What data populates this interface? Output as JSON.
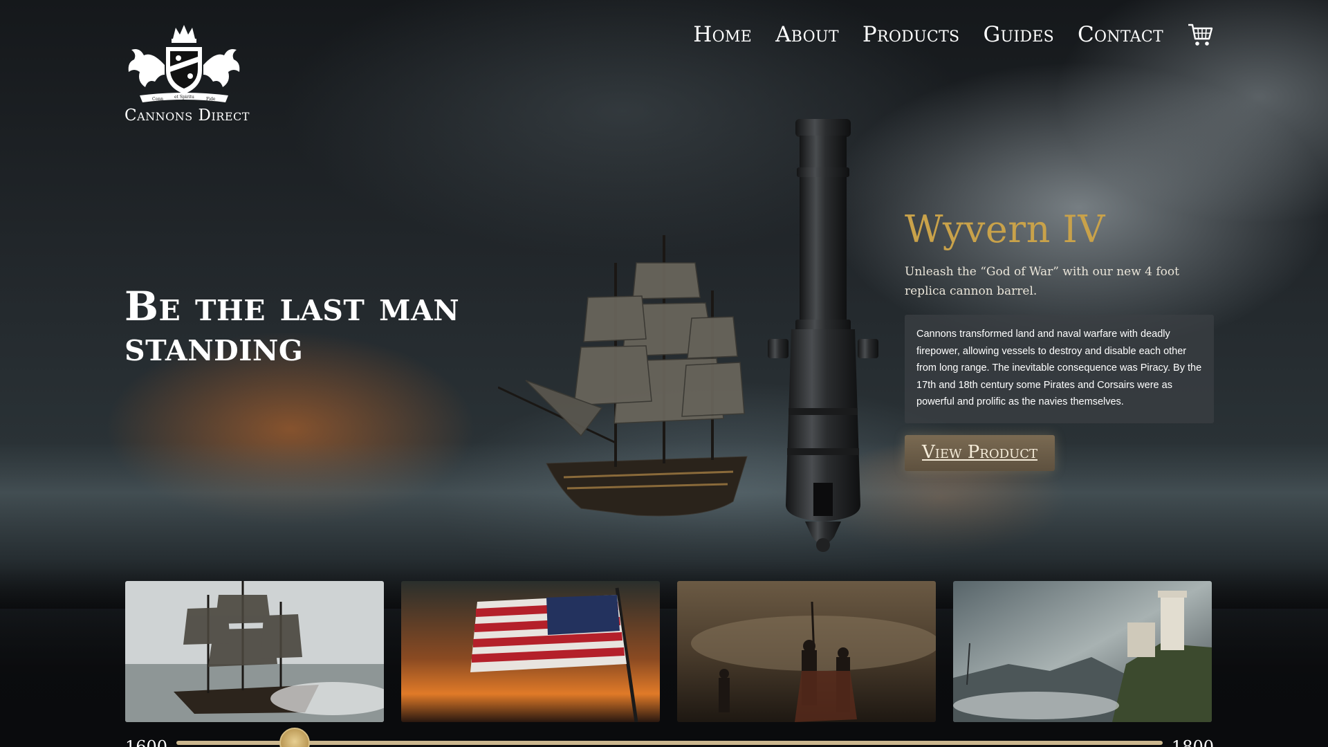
{
  "brand": {
    "name": "Cannons Direct",
    "motto_left": "Conn",
    "motto_center": "et Spiritu",
    "motto_right": "Fide"
  },
  "nav": {
    "items": [
      {
        "label": "Home"
      },
      {
        "label": "About"
      },
      {
        "label": "Products"
      },
      {
        "label": "Guides"
      },
      {
        "label": "Contact"
      }
    ],
    "cart_icon": "shopping-cart-icon"
  },
  "hero": {
    "headline": "Be the last man standing"
  },
  "product": {
    "name": "Wyvern IV",
    "tagline": "Unleash the “God of War” with our new 4 foot replica cannon barrel.",
    "description": "Cannons transformed land and naval warfare with deadly firepower, allowing vessels to destroy and disable each other from long range. The inevitable consequence was Piracy. By the 17th and 18th century some Pirates and Corsairs were as powerful and prolific as the navies themselves.",
    "button_label": "View Product"
  },
  "timeline": {
    "start_year": "1600",
    "end_year": "1800",
    "position": 0.12
  },
  "thumbnails": [
    {
      "subject": "tall-ship-at-sea"
    },
    {
      "subject": "american-flag-at-sunset"
    },
    {
      "subject": "battlefield-soldiers"
    },
    {
      "subject": "cliffside-castle"
    }
  ],
  "colors": {
    "accent_gold": "#c9a24a",
    "button_bg": "#6d5e49",
    "panel_bg": "#3c4044"
  }
}
